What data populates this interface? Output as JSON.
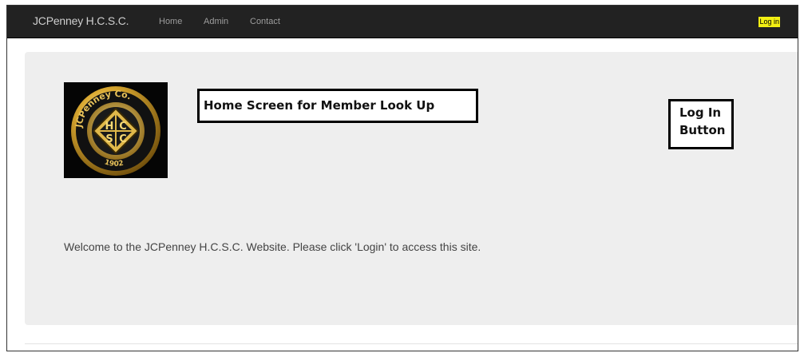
{
  "navbar": {
    "brand": "JCPenney H.C.S.C.",
    "links": [
      {
        "label": "Home"
      },
      {
        "label": "Admin"
      },
      {
        "label": "Contact"
      }
    ],
    "login_label": "Log in",
    "login_highlight_color": "#f2ef13",
    "background_color": "#222222"
  },
  "logo": {
    "icon": "jcpenney-co-hcsc-emblem",
    "text_ring": "JCPenney Co.",
    "center_letters": [
      "H",
      "C",
      "S",
      "C"
    ],
    "year": "1902"
  },
  "annotations": {
    "home_screen": "Home Screen for Member Look Up",
    "login_button_line1": "Log In",
    "login_button_line2": "Button"
  },
  "main": {
    "welcome_text": "Welcome to the JCPenney H.C.S.C. Website. Please click 'Login' to access this site."
  }
}
